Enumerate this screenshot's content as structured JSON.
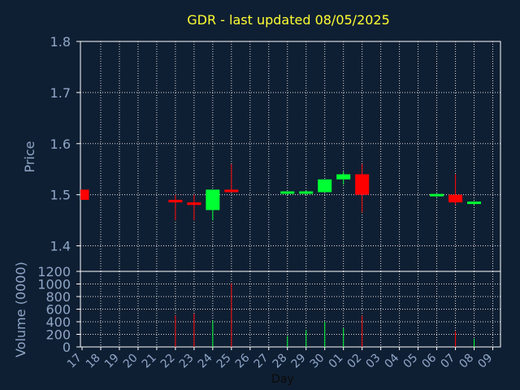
{
  "chart_data": [
    {
      "type": "candlestick",
      "title": "GDR - last updated 08/05/2025",
      "ylabel": "Price",
      "ylim": [
        1.35,
        1.8
      ],
      "yticks": [
        "1.4",
        "1.5",
        "1.6",
        "1.7",
        "1.8"
      ],
      "grid": true,
      "up_color": "#00ff33",
      "down_color": "#ff0000",
      "x": [
        "17",
        "18",
        "19",
        "20",
        "21",
        "22",
        "23",
        "24",
        "25",
        "26",
        "27",
        "28",
        "29",
        "30",
        "01",
        "02",
        "03",
        "04",
        "05",
        "06",
        "07",
        "08",
        "09"
      ],
      "candles": [
        {
          "x": "17",
          "open": 1.51,
          "high": 1.51,
          "low": 1.49,
          "close": 1.49
        },
        {
          "x": "22",
          "open": 1.49,
          "high": 1.5,
          "low": 1.45,
          "close": 1.485
        },
        {
          "x": "23",
          "open": 1.485,
          "high": 1.5,
          "low": 1.45,
          "close": 1.48
        },
        {
          "x": "24",
          "open": 1.47,
          "high": 1.51,
          "low": 1.45,
          "close": 1.51
        },
        {
          "x": "25",
          "open": 1.51,
          "high": 1.56,
          "low": 1.505,
          "close": 1.505
        },
        {
          "x": "28",
          "open": 1.502,
          "high": 1.506,
          "low": 1.5,
          "close": 1.505
        },
        {
          "x": "29",
          "open": 1.502,
          "high": 1.508,
          "low": 1.5,
          "close": 1.505
        },
        {
          "x": "30",
          "open": 1.505,
          "high": 1.53,
          "low": 1.505,
          "close": 1.53
        },
        {
          "x": "01",
          "open": 1.53,
          "high": 1.545,
          "low": 1.52,
          "close": 1.54
        },
        {
          "x": "02",
          "open": 1.54,
          "high": 1.56,
          "low": 1.465,
          "close": 1.5
        },
        {
          "x": "06",
          "open": 1.498,
          "high": 1.502,
          "low": 1.496,
          "close": 1.5
        },
        {
          "x": "07",
          "open": 1.5,
          "high": 1.54,
          "low": 1.48,
          "close": 1.485
        },
        {
          "x": "08",
          "open": 1.482,
          "high": 1.487,
          "low": 1.48,
          "close": 1.485
        }
      ]
    },
    {
      "type": "bar",
      "ylabel": "Volume (0000)",
      "xlabel": "Day",
      "ylim": [
        0,
        1200
      ],
      "yticks": [
        "0",
        "200",
        "400",
        "600",
        "800",
        "1000",
        "1200"
      ],
      "grid": true,
      "categories": [
        "17",
        "18",
        "19",
        "20",
        "21",
        "22",
        "23",
        "24",
        "25",
        "26",
        "27",
        "28",
        "29",
        "30",
        "01",
        "02",
        "03",
        "04",
        "05",
        "06",
        "07",
        "08",
        "09"
      ],
      "bars": [
        {
          "x": "22",
          "value": 500,
          "color": "#ff0000"
        },
        {
          "x": "23",
          "value": 530,
          "color": "#ff0000"
        },
        {
          "x": "24",
          "value": 420,
          "color": "#00ff33"
        },
        {
          "x": "25",
          "value": 1010,
          "color": "#ff0000"
        },
        {
          "x": "28",
          "value": 170,
          "color": "#00ff33"
        },
        {
          "x": "29",
          "value": 270,
          "color": "#00ff33"
        },
        {
          "x": "30",
          "value": 400,
          "color": "#00ff33"
        },
        {
          "x": "01",
          "value": 300,
          "color": "#00ff33"
        },
        {
          "x": "02",
          "value": 500,
          "color": "#ff0000"
        },
        {
          "x": "07",
          "value": 250,
          "color": "#ff0000"
        },
        {
          "x": "08",
          "value": 130,
          "color": "#00ff33"
        }
      ]
    }
  ]
}
